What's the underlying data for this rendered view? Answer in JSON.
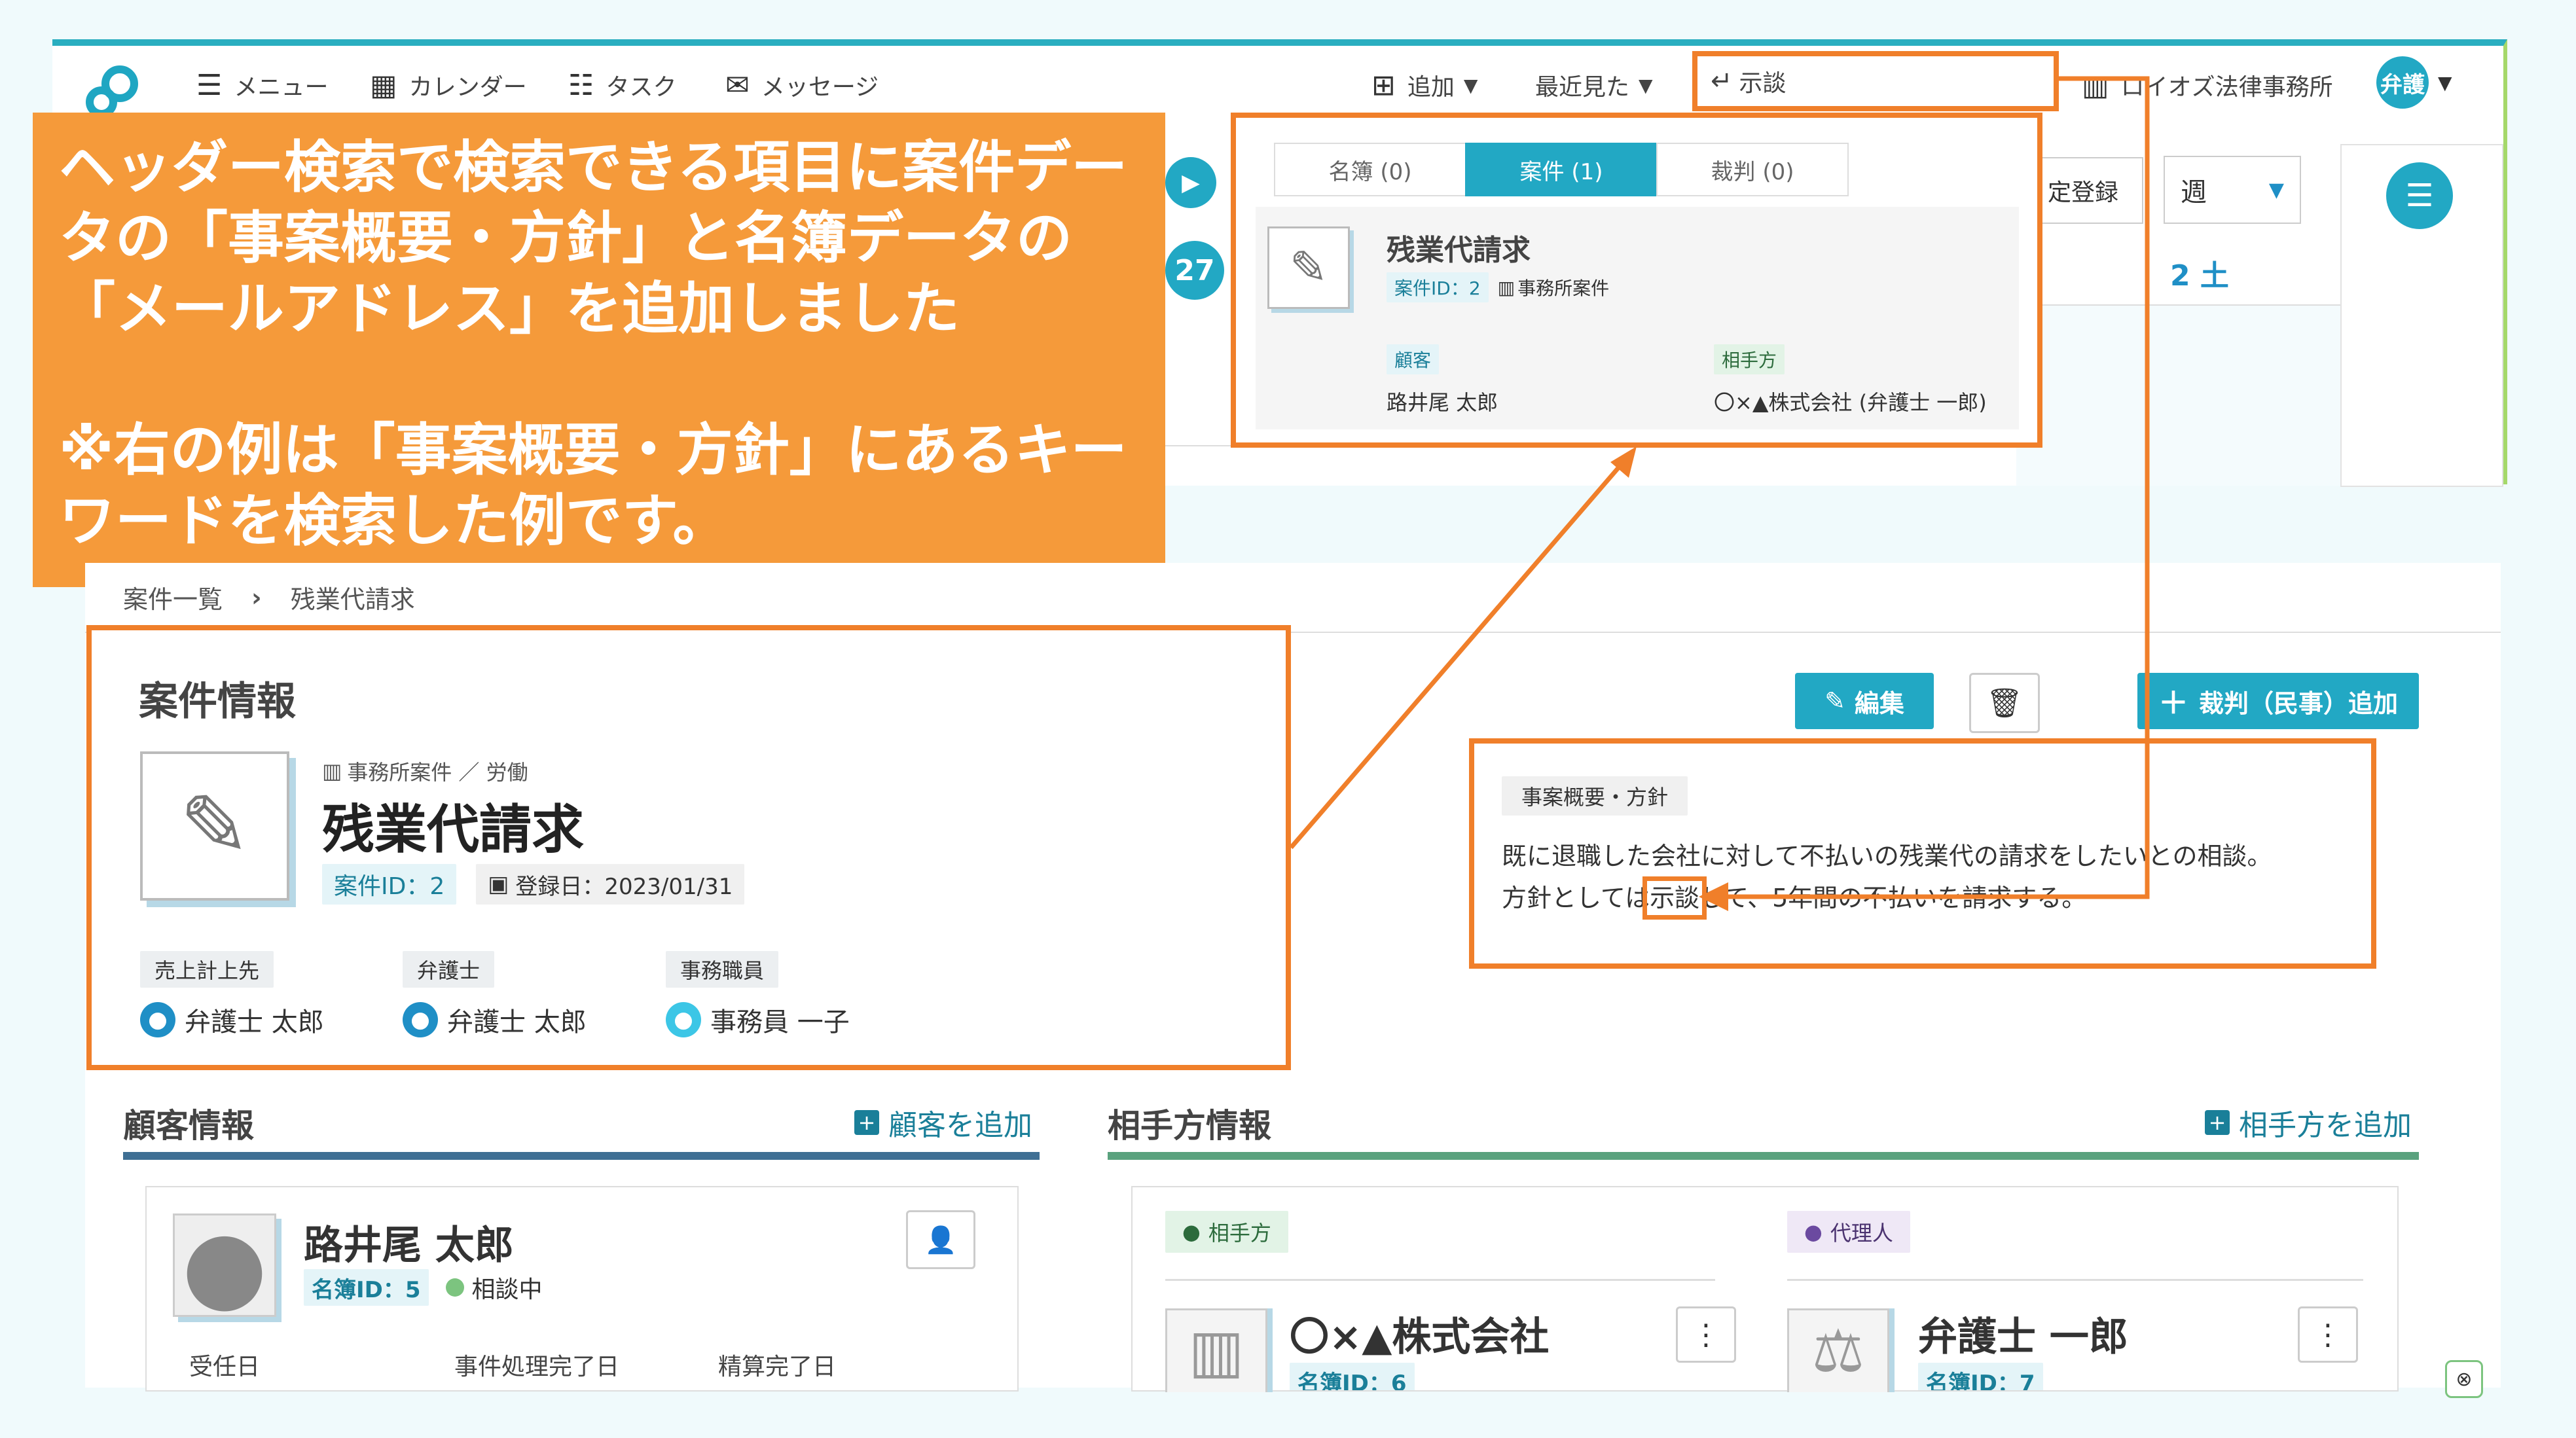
{
  "header": {
    "nav": [
      {
        "icon": "menu-icon",
        "label": "メニュー"
      },
      {
        "icon": "calendar-icon",
        "label": "カレンダー"
      },
      {
        "icon": "task-list-icon",
        "label": "タスク"
      },
      {
        "icon": "mail-icon",
        "label": "メッセージ"
      }
    ],
    "add_label": "追加",
    "recent_label": "最近見た",
    "search_value": "示談",
    "firm_name": "ロイオズ法律事務所",
    "user_badge": "弁護"
  },
  "calendar": {
    "day_27": "27",
    "register_label": "定登録",
    "view_select": "週",
    "date_label": "2 土"
  },
  "callout": {
    "line1": "ヘッダー検索で検索できる項目に案件データの「事案概要・方針」と名簿データの「メールアドレス」を追加しました",
    "line2": "※右の例は「事案概要・方針」にあるキーワードを検索した例です。"
  },
  "dropdown": {
    "tabs": [
      "名簿 (0)",
      "案件 (1)",
      "裁判 (0)"
    ],
    "active_tab": 1,
    "result": {
      "title": "残業代請求",
      "id_chip": "案件ID：2",
      "office_chip": "事務所案件",
      "client_label": "顧客",
      "client_name": "路井尾 太郎",
      "opponent_label": "相手方",
      "opponent_name": "〇×▲株式会社 (弁護士 一郎)"
    }
  },
  "breadcrumb": [
    "案件一覧",
    "残業代請求"
  ],
  "case_info": {
    "section_title": "案件情報",
    "category": "事務所案件 ／ 労働",
    "title": "残業代請求",
    "id_chip": "案件ID：2",
    "registered": "登録日：2023/01/31",
    "roles": [
      {
        "label": "売上計上先",
        "name": "弁護士 太郎"
      },
      {
        "label": "弁護士",
        "name": "弁護士 太郎"
      },
      {
        "label": "事務職員",
        "name": "事務員 一子"
      }
    ]
  },
  "actions": {
    "edit": "編集",
    "add_trial": "裁判（民事）追加"
  },
  "summary": {
    "label": "事案概要・方針",
    "text_line1": "既に退職した会社に対して不払いの残業代の請求をしたいとの相談。",
    "text_line2_prefix": "方針としては",
    "text_line2_highlight": "示談",
    "text_line2_suffix": "して、5年間の不払いを請求する。"
  },
  "client_section": {
    "title": "顧客情報",
    "add_link": "顧客を追加",
    "name": "路井尾 太郎",
    "id_chip": "名簿ID：5",
    "status": "相談中",
    "fields": [
      "受任日",
      "事件処理完了日",
      "精算完了日"
    ]
  },
  "opponent_section": {
    "title": "相手方情報",
    "add_link": "相手方を追加",
    "tag_opponent": "相手方",
    "tag_agent": "代理人",
    "opponent_name": "〇×▲株式会社",
    "opponent_id": "名簿ID：6",
    "agent_name": "弁護士 一郎",
    "agent_id": "名簿ID：7"
  },
  "colors": {
    "accent": "#22a8c4",
    "callout": "#f59a3a",
    "highlight_border": "#f07f2a"
  }
}
